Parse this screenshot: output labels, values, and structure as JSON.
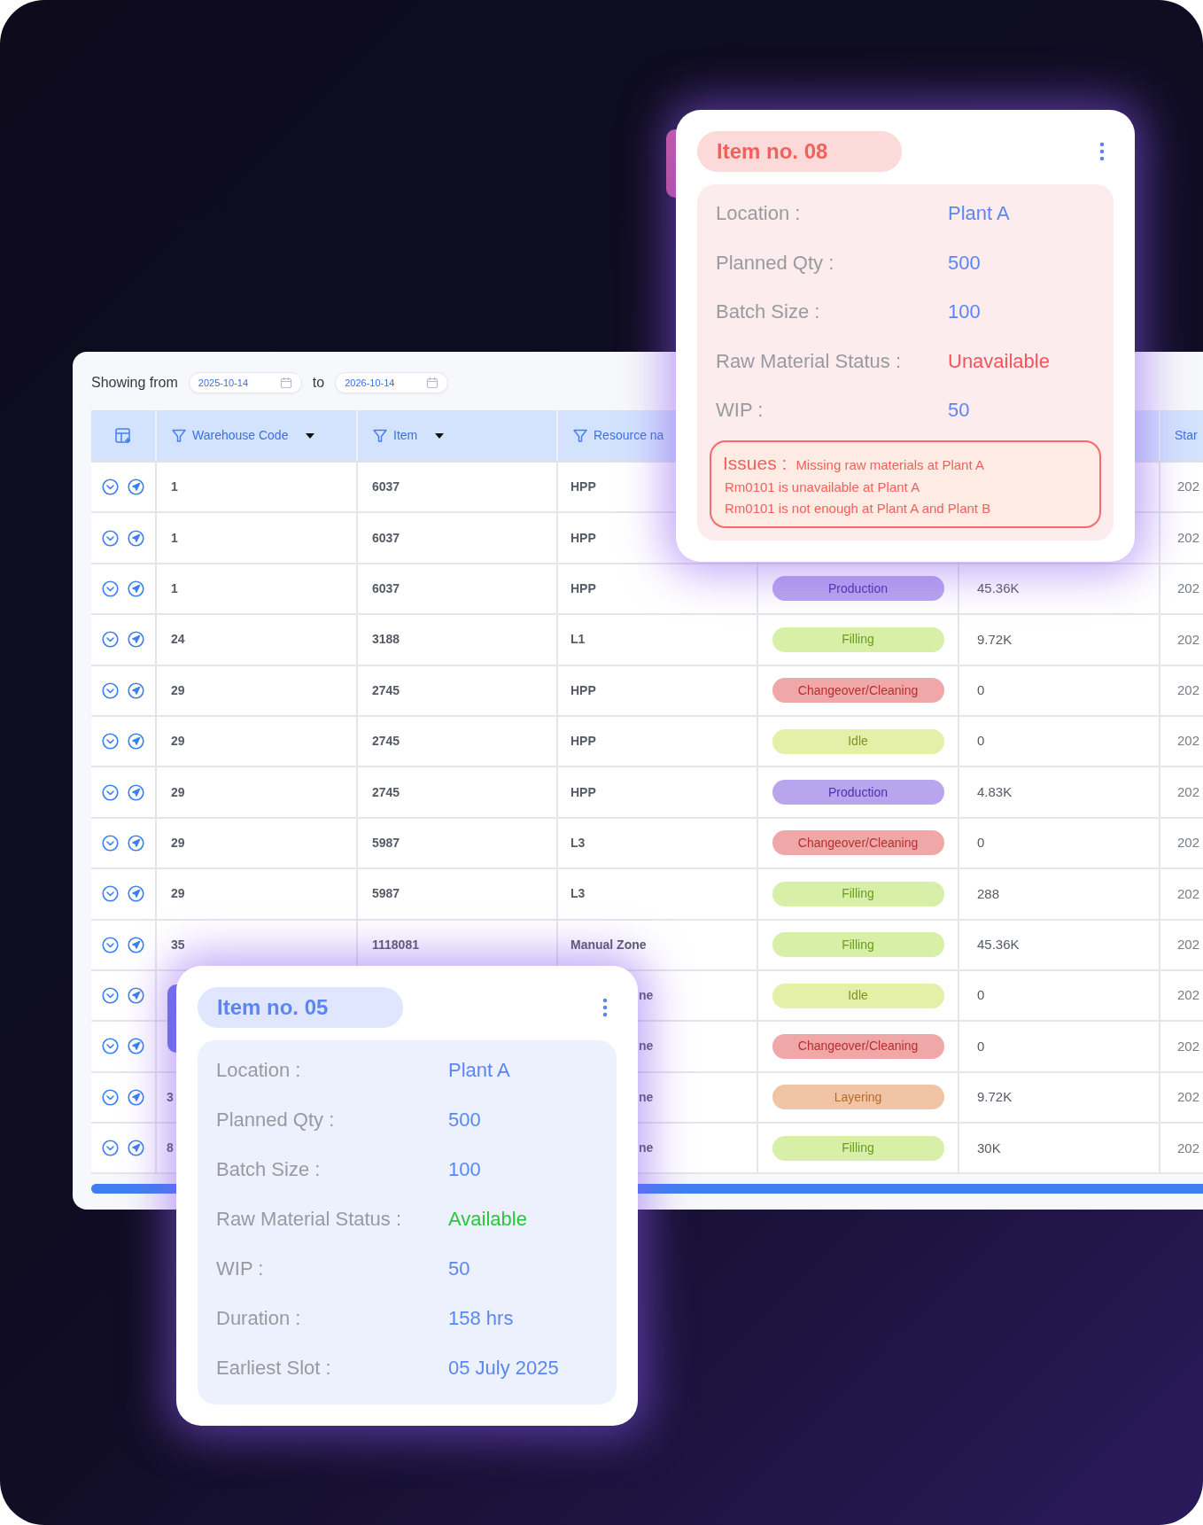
{
  "filter": {
    "label": "Showing from",
    "from": "2025-10-14",
    "to_label": "to",
    "to": "2026-10-14"
  },
  "table": {
    "columns": [
      "Warehouse Code",
      "Item",
      "Resource na",
      "Star"
    ],
    "rows": [
      {
        "warehouse": "1",
        "item": "6037",
        "resource": "HPP",
        "start": "202"
      },
      {
        "warehouse": "1",
        "item": "6037",
        "resource": "HPP",
        "start": "202"
      },
      {
        "warehouse": "1",
        "item": "6037",
        "resource": "HPP",
        "status": {
          "label": "Production",
          "kind": "production"
        },
        "qty": "45.36K",
        "start": "202"
      },
      {
        "warehouse": "24",
        "item": "3188",
        "resource": "L1",
        "status": {
          "label": "Filling",
          "kind": "filling"
        },
        "qty": "9.72K",
        "start": "202"
      },
      {
        "warehouse": "29",
        "item": "2745",
        "resource": "HPP",
        "status": {
          "label": "Changeover/Cleaning",
          "kind": "changeover"
        },
        "qty": "0",
        "start": "202"
      },
      {
        "warehouse": "29",
        "item": "2745",
        "resource": "HPP",
        "status": {
          "label": "Idle",
          "kind": "idle"
        },
        "qty": "0",
        "start": "202"
      },
      {
        "warehouse": "29",
        "item": "2745",
        "resource": "HPP",
        "status": {
          "label": "Production",
          "kind": "production"
        },
        "qty": "4.83K",
        "start": "202"
      },
      {
        "warehouse": "29",
        "item": "5987",
        "resource": "L3",
        "status": {
          "label": "Changeover/Cleaning",
          "kind": "changeover"
        },
        "qty": "0",
        "start": "202"
      },
      {
        "warehouse": "29",
        "item": "5987",
        "resource": "L3",
        "status": {
          "label": "Filling",
          "kind": "filling"
        },
        "qty": "288",
        "start": "202"
      },
      {
        "warehouse": "35",
        "item": "1118081",
        "resource": "Manual Zone",
        "status": {
          "label": "Filling",
          "kind": "filling"
        },
        "qty": "45.36K",
        "start": "202"
      },
      {
        "covered": true,
        "resource": "ne",
        "status": {
          "label": "Idle",
          "kind": "idle"
        },
        "qty": "0",
        "start": "202"
      },
      {
        "covered": true,
        "resource": "ne",
        "status": {
          "label": "Changeover/Cleaning",
          "kind": "changeover"
        },
        "qty": "0",
        "start": "202"
      },
      {
        "covered": true,
        "warehouse": "3",
        "resource": "ne",
        "status": {
          "label": "Layering",
          "kind": "layering"
        },
        "qty": "9.72K",
        "start": "202"
      },
      {
        "covered": true,
        "warehouse": "8",
        "resource": "ne",
        "status": {
          "label": "Filling",
          "kind": "filling"
        },
        "qty": "30K",
        "start": "202"
      }
    ]
  },
  "cards": [
    {
      "kind": "danger",
      "title": "Item no. 08",
      "fields": [
        {
          "label": "Location :",
          "value": "Plant A",
          "kind": "normal"
        },
        {
          "label": "Planned Qty :",
          "value": "500",
          "kind": "normal"
        },
        {
          "label": "Batch Size :",
          "value": "100",
          "kind": "normal"
        },
        {
          "label": "Raw Material Status :",
          "value": "Unavailable",
          "kind": "bad"
        },
        {
          "label": "WIP :",
          "value": "50",
          "kind": "normal"
        }
      ],
      "issues": {
        "label": "Issues :",
        "messages": [
          "Missing raw materials at Plant A",
          "Rm0101 is unavailable at Plant A",
          "Rm0101 is not enough at Plant A and Plant B"
        ]
      }
    },
    {
      "kind": "info",
      "title": "Item no. 05",
      "fields": [
        {
          "label": "Location :",
          "value": "Plant A",
          "kind": "normal"
        },
        {
          "label": "Planned Qty :",
          "value": "500",
          "kind": "normal"
        },
        {
          "label": "Batch Size :",
          "value": "100",
          "kind": "normal"
        },
        {
          "label": "Raw Material Status :",
          "value": "Available",
          "kind": "good"
        },
        {
          "label": "WIP :",
          "value": "50",
          "kind": "normal"
        },
        {
          "label": "Duration :",
          "value": "158 hrs",
          "kind": "normal"
        },
        {
          "label": "Earliest Slot :",
          "value": "05 July 2025",
          "kind": "normal"
        }
      ]
    }
  ]
}
